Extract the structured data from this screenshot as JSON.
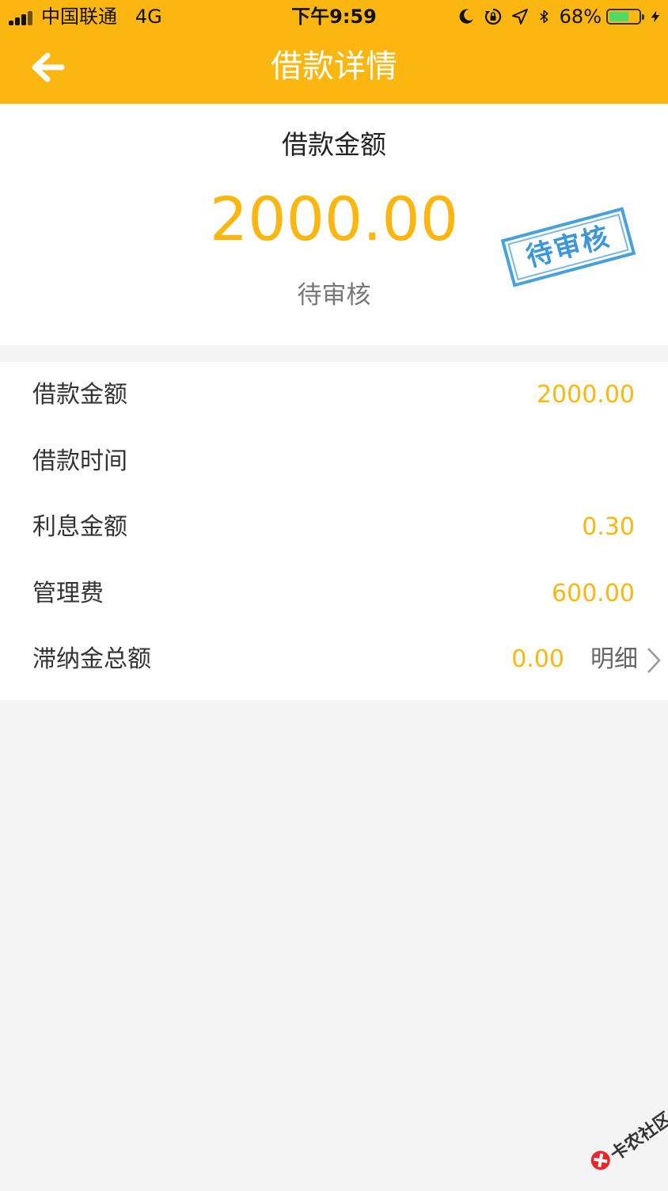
{
  "status_bar": {
    "carrier": "中国联通",
    "network": "4G",
    "time": "下午9:59",
    "battery_percent": "68%",
    "battery_level": 0.68,
    "icons": [
      "moon-icon",
      "rotation-lock-icon",
      "location-icon",
      "bluetooth-icon",
      "charging-icon"
    ]
  },
  "nav": {
    "title": "借款详情",
    "back_icon": "arrow-left-icon"
  },
  "summary": {
    "label": "借款金额",
    "amount": "2000.00",
    "status": "待审核",
    "stamp_text": "待审核"
  },
  "details": {
    "rows": [
      {
        "label": "借款金额",
        "value": "2000.00"
      },
      {
        "label": "借款时间",
        "value": ""
      },
      {
        "label": "利息金额",
        "value": "0.30"
      },
      {
        "label": "管理费",
        "value": "600.00"
      },
      {
        "label": "滞纳金总额",
        "value": "0.00",
        "link": "明细"
      }
    ]
  },
  "watermark": {
    "text": "卡农社区"
  },
  "colors": {
    "accent": "#fbb70f",
    "background": "#f4f4f4",
    "stamp": "#2a8fd8"
  }
}
